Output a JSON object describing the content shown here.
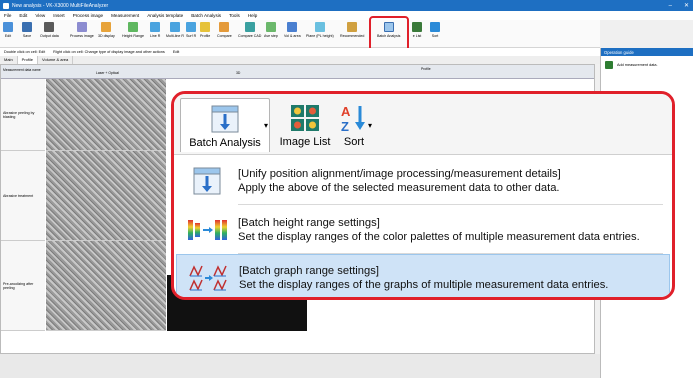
{
  "window": {
    "title": "New analysis - VK-X3000 MultiFileAnalyzer",
    "min": "–",
    "close": "✕"
  },
  "menu": [
    "File",
    "Edit",
    "View",
    "Insert",
    "Process image",
    "Measurement",
    "Analysis template",
    "Batch Analysis",
    "Tools",
    "Help"
  ],
  "ribbon": {
    "buttons": [
      "Edit",
      "Save",
      "Output data",
      "Process image",
      "3D display",
      "Height Range",
      "Line R",
      "Multi-line R",
      "Surf R",
      "Profile",
      "Compare",
      "Compare CAD",
      "Ave step",
      "Vol & area",
      "Plane (PL height)",
      "Recommended",
      "Batch Analysis",
      "e List",
      "Sort"
    ]
  },
  "subbar": {
    "hint1": "Double click on cell: Edit",
    "hint2": "Right click on cell: Change type of display image and other actions",
    "edit": "Edit"
  },
  "tabs": [
    "Main",
    "Profile",
    "Volume & area"
  ],
  "grid": {
    "headers": [
      "Measurement data name",
      "Laser + Optical",
      "3D",
      "Profile"
    ],
    "rows": [
      "Abrasive peeling by blasting",
      "Abrasive treatment",
      "Pre-anodizing after peeling"
    ]
  },
  "right_panel": {
    "title": "Operation guide",
    "items": [
      "Add measurement data."
    ]
  },
  "popup": {
    "toolbar": {
      "batch_analysis": "Batch Analysis",
      "image_list": "Image List",
      "sort": "Sort",
      "dropdown_glyph": "▾"
    },
    "items": [
      {
        "line1": "[Unify position alignment/image processing/measurement details]",
        "line2": "Apply the above of the selected measurement data to other data."
      },
      {
        "line1": "[Batch height range settings]",
        "line2": "Set the display ranges of the color palettes of multiple measurement data entries."
      },
      {
        "line1": "[Batch graph range settings]",
        "line2": "Set the display ranges of the graphs of multiple measurement data entries."
      }
    ]
  },
  "colors": {
    "highlight_border": "#e0202a",
    "selected_item_bg": "#cfe3f7",
    "title_blue": "#1e6fc2"
  }
}
